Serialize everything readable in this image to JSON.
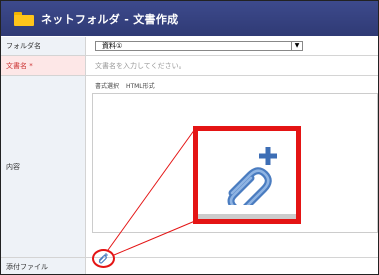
{
  "window": {
    "title": "ネットフォルダ - 文書作成"
  },
  "form": {
    "folder_label": "フォルダ名",
    "folder_value": "資料①",
    "docname_label": "文書名 *",
    "docname_placeholder": "文書名を入力してください。",
    "content_label": "内容",
    "editor_tabs": [
      "書式選択",
      "HTML形式"
    ],
    "attach_label": "添付ファイル"
  },
  "colors": {
    "titlebar": "#34417f",
    "highlight": "#e41414",
    "required_bg": "#fde7e7",
    "label_bg": "#eef2f7",
    "clip": "#4a7cc0"
  },
  "icons": {
    "title": "folder-icon",
    "attach": "paperclip-add-icon"
  }
}
